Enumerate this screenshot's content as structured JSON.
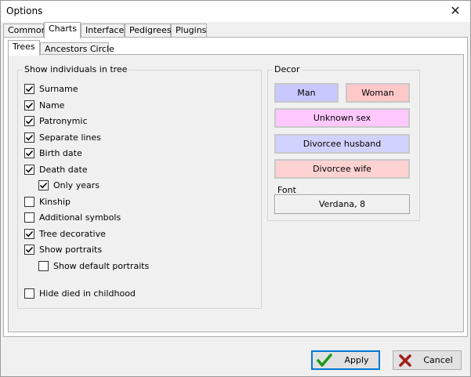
{
  "window": {
    "title": "Options",
    "close_glyph": "✕"
  },
  "tabs": [
    "Common",
    "Charts",
    "Interface",
    "Pedigrees",
    "Plugins"
  ],
  "inner_tabs": [
    "Trees",
    "Ancestors Circle"
  ],
  "individuals": {
    "label": "Show individuals in tree",
    "options": [
      {
        "label": "Surname",
        "checked": true
      },
      {
        "label": "Name",
        "checked": true
      },
      {
        "label": "Patronymic",
        "checked": true
      },
      {
        "label": "Separate lines",
        "checked": true
      },
      {
        "label": "Birth date",
        "checked": true
      },
      {
        "label": "Death date",
        "checked": true
      },
      {
        "label": "Only years",
        "checked": true
      },
      {
        "label": "Kinship",
        "checked": false
      },
      {
        "label": "Additional symbols",
        "checked": false
      },
      {
        "label": "Tree decorative",
        "checked": true
      },
      {
        "label": "Show portraits",
        "checked": true
      },
      {
        "label": "Show default portraits",
        "checked": false
      },
      {
        "label": "Hide died in childhood",
        "checked": false
      }
    ]
  },
  "decor": {
    "label": "Decor",
    "man": {
      "label": "Man",
      "color": "#c8c8ff"
    },
    "woman": {
      "label": "Woman",
      "color": "#ffc8c8"
    },
    "unknown": {
      "label": "Unknown sex",
      "color": "#ffc8ff"
    },
    "divorcee_husband": {
      "label": "Divorcee husband",
      "color": "#d2d2ff"
    },
    "divorcee_wife": {
      "label": "Divorcee wife",
      "color": "#ffd2d2"
    },
    "font_label": "Font",
    "font_value": "Verdana, 8"
  },
  "buttons": {
    "apply": "Apply",
    "cancel": "Cancel"
  }
}
